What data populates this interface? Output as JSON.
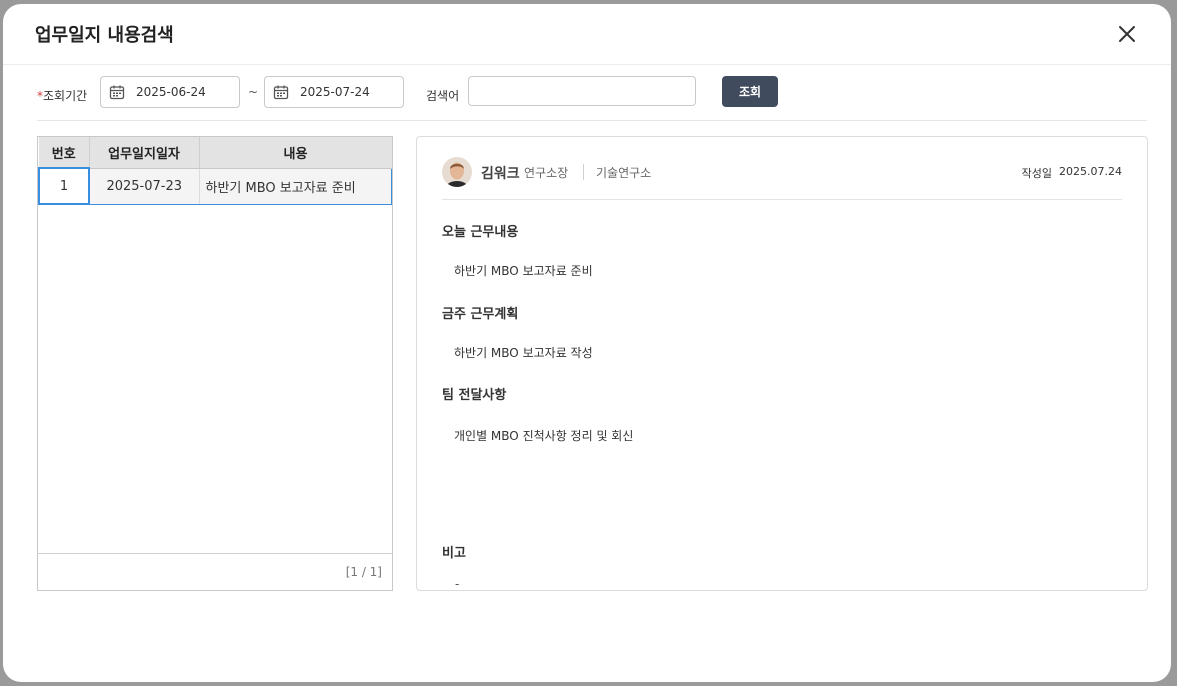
{
  "modal": {
    "title": "업무일지 내용검색"
  },
  "filters": {
    "period_label": "조회기간",
    "required_mark": "*",
    "start_date": "2025-06-24",
    "tilde": "~",
    "end_date": "2025-07-24",
    "keyword_label": "검색어",
    "keyword_value": "",
    "search_button": "조회"
  },
  "grid": {
    "columns": [
      "번호",
      "업무일지일자",
      "내용"
    ],
    "rows": [
      {
        "no": "1",
        "date": "2025-07-23",
        "content": "하반기 MBO 보고자료 준비"
      }
    ],
    "pager": "[1 / 1]"
  },
  "detail": {
    "author_name": "김워크",
    "author_title": "연구소장",
    "author_dept": "기술연구소",
    "written_label": "작성일",
    "written_date": "2025.07.24",
    "sections": [
      {
        "title": "오늘 근무내용",
        "body": "하반기 MBO 보고자료 준비"
      },
      {
        "title": "금주 근무계획",
        "body": "하반기 MBO 보고자료 작성"
      },
      {
        "title": "팀 전달사항",
        "body": "개인별 MBO 진척사항 정리 및 회신"
      }
    ],
    "remark_title": "비고",
    "remark_body": "-"
  },
  "colors": {
    "primary_button": "#414b5e",
    "selection": "#3a8ee0",
    "required": "#d43b3b"
  },
  "icons": [
    "close-icon",
    "calendar-icon",
    "avatar"
  ]
}
